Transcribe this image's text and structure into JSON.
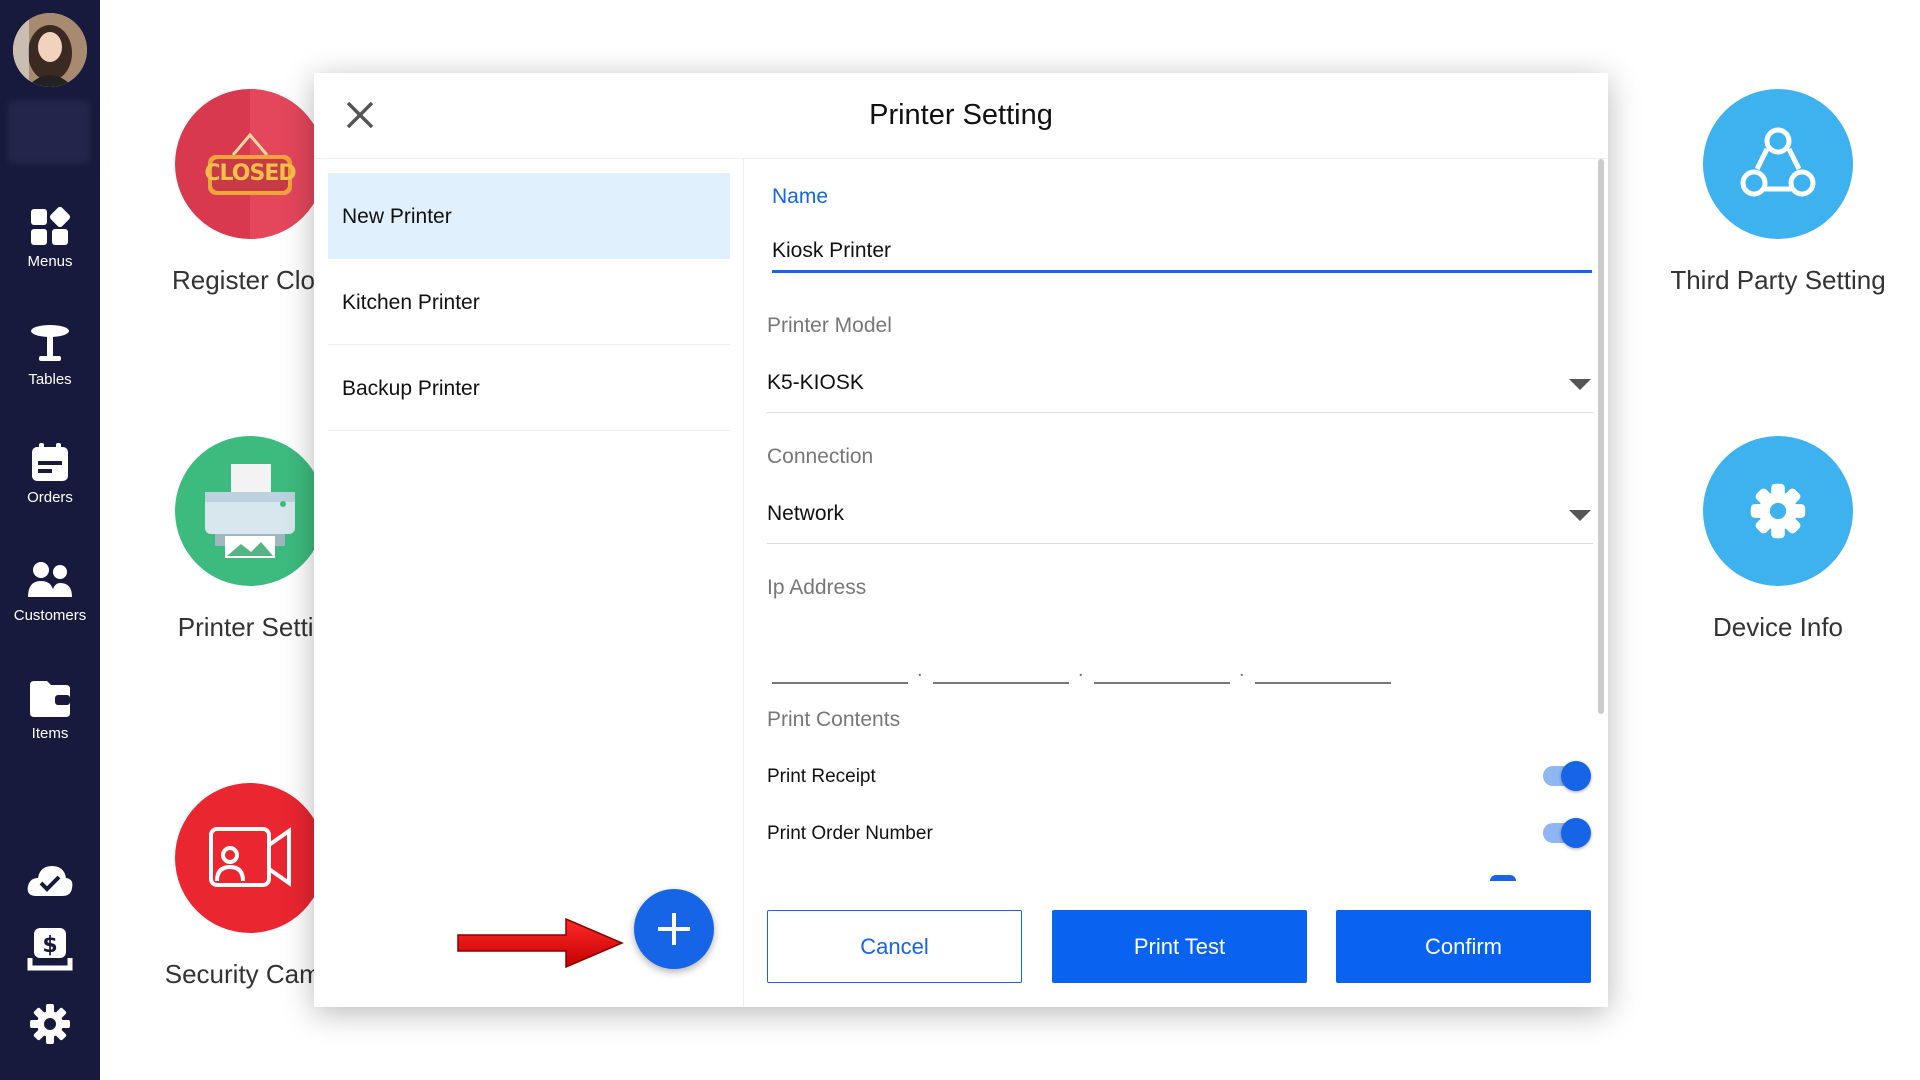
{
  "sidebar": {
    "items": [
      {
        "label": "Menus",
        "icon": "grid-icon"
      },
      {
        "label": "Tables",
        "icon": "table-icon"
      },
      {
        "label": "Orders",
        "icon": "orders-icon"
      },
      {
        "label": "Customers",
        "icon": "customers-icon"
      },
      {
        "label": "Items",
        "icon": "wallet-icon"
      }
    ],
    "bottom_icons": [
      "cloud-check-icon",
      "cash-icon",
      "gear-icon"
    ]
  },
  "tiles": {
    "register_closed": {
      "label": "Register Clos",
      "badge": "CLOSED",
      "color": "#d8394e"
    },
    "printer_setting": {
      "label": "Printer Settir",
      "color": "#3dbb7e"
    },
    "security_camera": {
      "label": "Security Came",
      "color": "#ea2630"
    },
    "third_party": {
      "label": "Third Party Setting",
      "color": "#3eb1ef"
    },
    "device_info": {
      "label": "Device Info",
      "color": "#3eb1ef"
    }
  },
  "modal": {
    "title": "Printer Setting",
    "printers": [
      {
        "label": "New Printer",
        "active": true
      },
      {
        "label": "Kitchen Printer",
        "active": false
      },
      {
        "label": "Backup Printer",
        "active": false
      }
    ],
    "form": {
      "name_label": "Name",
      "name_value": "Kiosk Printer",
      "model_label": "Printer Model",
      "model_value": "K5-KIOSK",
      "connection_label": "Connection",
      "connection_value": "Network",
      "ip_label": "Ip Address",
      "ip_dot": ".",
      "contents_label": "Print Contents",
      "toggles": [
        {
          "label": "Print Receipt",
          "on": true
        },
        {
          "label": "Print Order Number",
          "on": true
        }
      ]
    },
    "buttons": {
      "cancel": "Cancel",
      "print_test": "Print Test",
      "confirm": "Confirm"
    }
  },
  "colors": {
    "accent": "#1565e6",
    "sidebar_bg": "#171a3c"
  }
}
